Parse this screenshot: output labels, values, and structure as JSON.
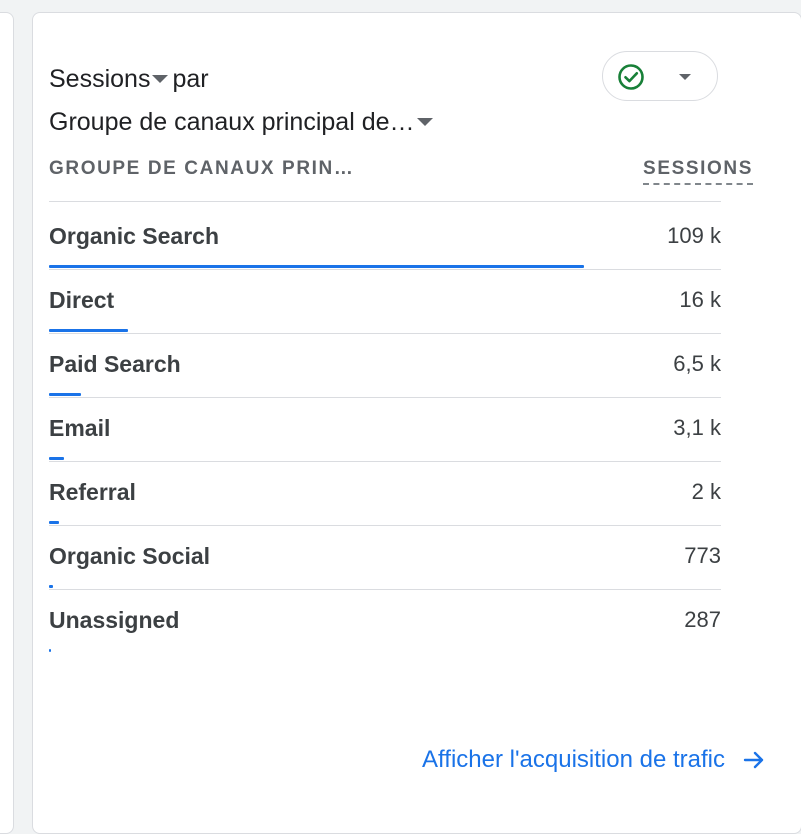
{
  "card": {
    "metric_label": "Sessions",
    "par_label": "par",
    "dimension_label": "Groupe de canaux principal de…",
    "status": "check-circle-icon",
    "table": {
      "dimension_header": "GROUPE DE CANAUX PRIN…",
      "metric_header": "SESSIONS",
      "rows": [
        {
          "name": "Organic Search",
          "value": "109 k",
          "share": 109000
        },
        {
          "name": "Direct",
          "value": "16 k",
          "share": 16000
        },
        {
          "name": "Paid Search",
          "value": "6,5 k",
          "share": 6500
        },
        {
          "name": "Email",
          "value": "3,1 k",
          "share": 3100
        },
        {
          "name": "Referral",
          "value": "2 k",
          "share": 2000
        },
        {
          "name": "Organic Social",
          "value": "773",
          "share": 773
        },
        {
          "name": "Unassigned",
          "value": "287",
          "share": 287
        }
      ]
    },
    "link_label": "Afficher l'acquisition de trafic"
  },
  "colors": {
    "accent": "#1a73e8",
    "success": "#188038",
    "border": "#dadce0"
  }
}
